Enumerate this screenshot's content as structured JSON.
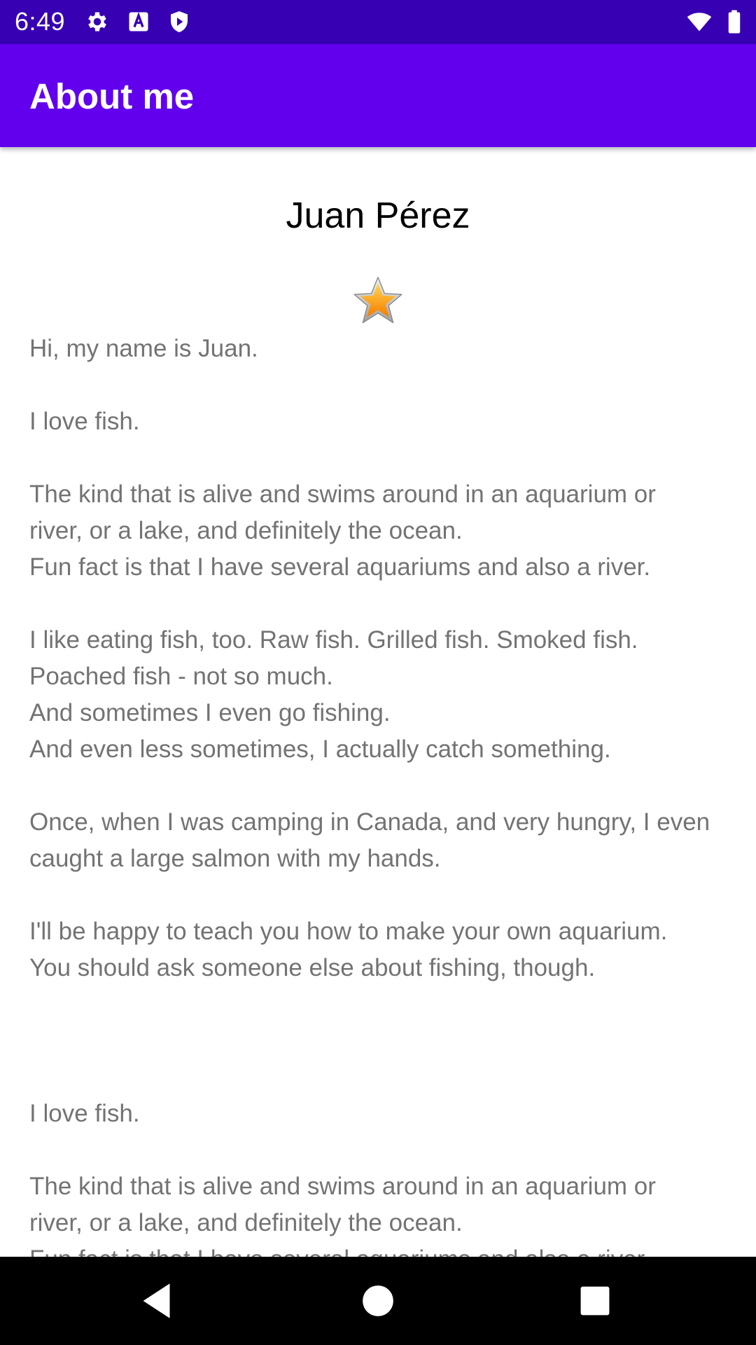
{
  "status_bar": {
    "time": "6:49",
    "icons": [
      "gear-icon",
      "text-a-icon",
      "shield-play-icon",
      "wifi-icon",
      "battery-icon"
    ]
  },
  "app_bar": {
    "title": "About me",
    "background": "#6200ee"
  },
  "profile": {
    "name": "Juan Pérez",
    "icon": "star-icon",
    "bio": "Hi, my name is Juan.\n\nI love fish.\n\nThe kind that is alive and swims around in an aquarium or\nriver, or a lake, and definitely the ocean.\nFun fact is that I have several aquariums and also a river.\n\nI like eating fish, too. Raw fish. Grilled fish. Smoked fish.\nPoached fish - not so much.\nAnd sometimes I even go fishing.\nAnd even less sometimes, I actually catch something.\n\nOnce, when I was camping in Canada, and very hungry, I even\ncaught a large salmon with my hands.\n\nI'll be happy to teach you how to make your own aquarium.\nYou should ask someone else about fishing, though.\n\n\n\nI love fish.\n\nThe kind that is alive and swims around in an aquarium or\nriver, or a lake, and definitely the ocean.\nFun fact is that I have several aquariums and also a river."
  },
  "nav_bar": {
    "buttons": [
      "back-icon",
      "home-icon",
      "recents-icon"
    ]
  },
  "colors": {
    "status_bar": "#3700b3",
    "app_bar": "#6200ee",
    "bio_text": "#737373"
  }
}
